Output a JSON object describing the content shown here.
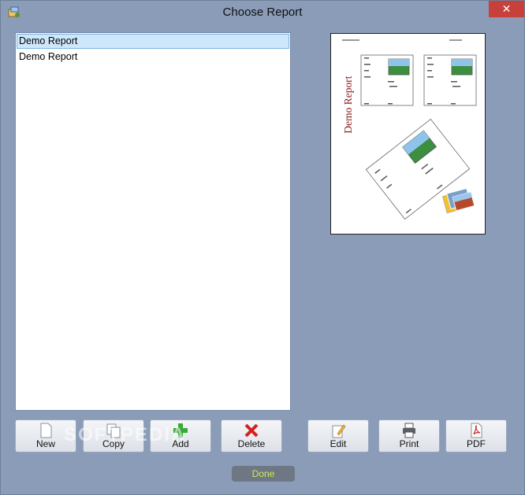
{
  "window": {
    "title": "Choose Report",
    "close_label": "✕"
  },
  "report_list": {
    "items": [
      "Demo Report",
      "Demo Report"
    ],
    "selected_index": 0
  },
  "preview": {
    "heading": "Demo Report"
  },
  "buttons": {
    "new": "New",
    "copy": "Copy",
    "add": "Add",
    "delete": "Delete",
    "edit": "Edit",
    "print": "Print",
    "pdf": "PDF",
    "done": "Done"
  },
  "watermark": "SOFTPEDIA",
  "colors": {
    "background": "#8a9cb8",
    "selected_row": "#cfe7fb",
    "close_button": "#c7403a",
    "done_text": "#c8ef52",
    "preview_title": "#8b1a1a"
  }
}
